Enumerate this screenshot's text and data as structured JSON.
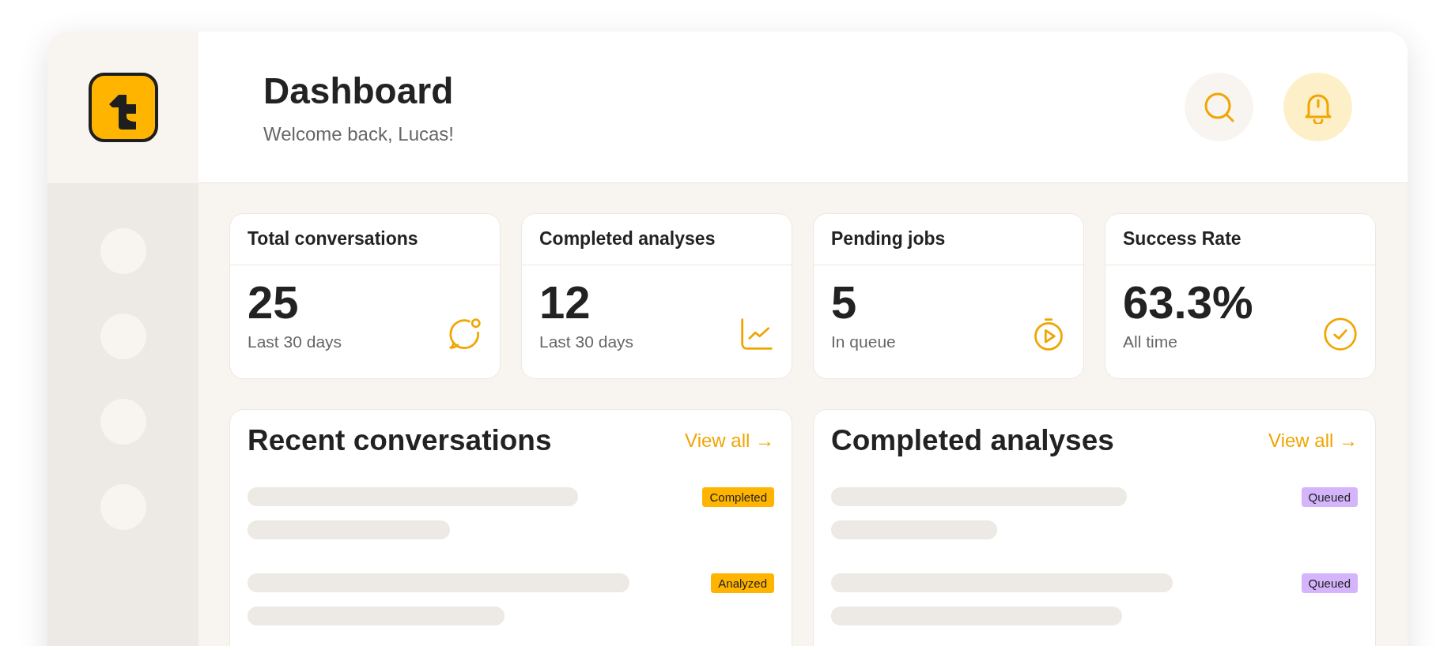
{
  "header": {
    "title": "Dashboard",
    "subtitle": "Welcome back, Lucas!"
  },
  "stats": [
    {
      "title": "Total conversations",
      "value": "25",
      "caption": "Last 30 days"
    },
    {
      "title": "Completed analyses",
      "value": "12",
      "caption": "Last 30 days"
    },
    {
      "title": "Pending jobs",
      "value": "5",
      "caption": "In queue"
    },
    {
      "title": "Success Rate",
      "value": "63.3%",
      "caption": "All time"
    }
  ],
  "panels": [
    {
      "title": "Recent conversations",
      "link": "View all →",
      "rows": [
        {
          "badge": "Completed",
          "color": "#ffb400"
        },
        {
          "badge": "Analyzed",
          "color": "#ffb400"
        }
      ]
    },
    {
      "title": "Completed analyses",
      "link": "View all →",
      "rows": [
        {
          "badge": "Queued",
          "color": "#d4b4fb"
        },
        {
          "badge": "Queued",
          "color": "#d4b4fb"
        }
      ]
    }
  ]
}
